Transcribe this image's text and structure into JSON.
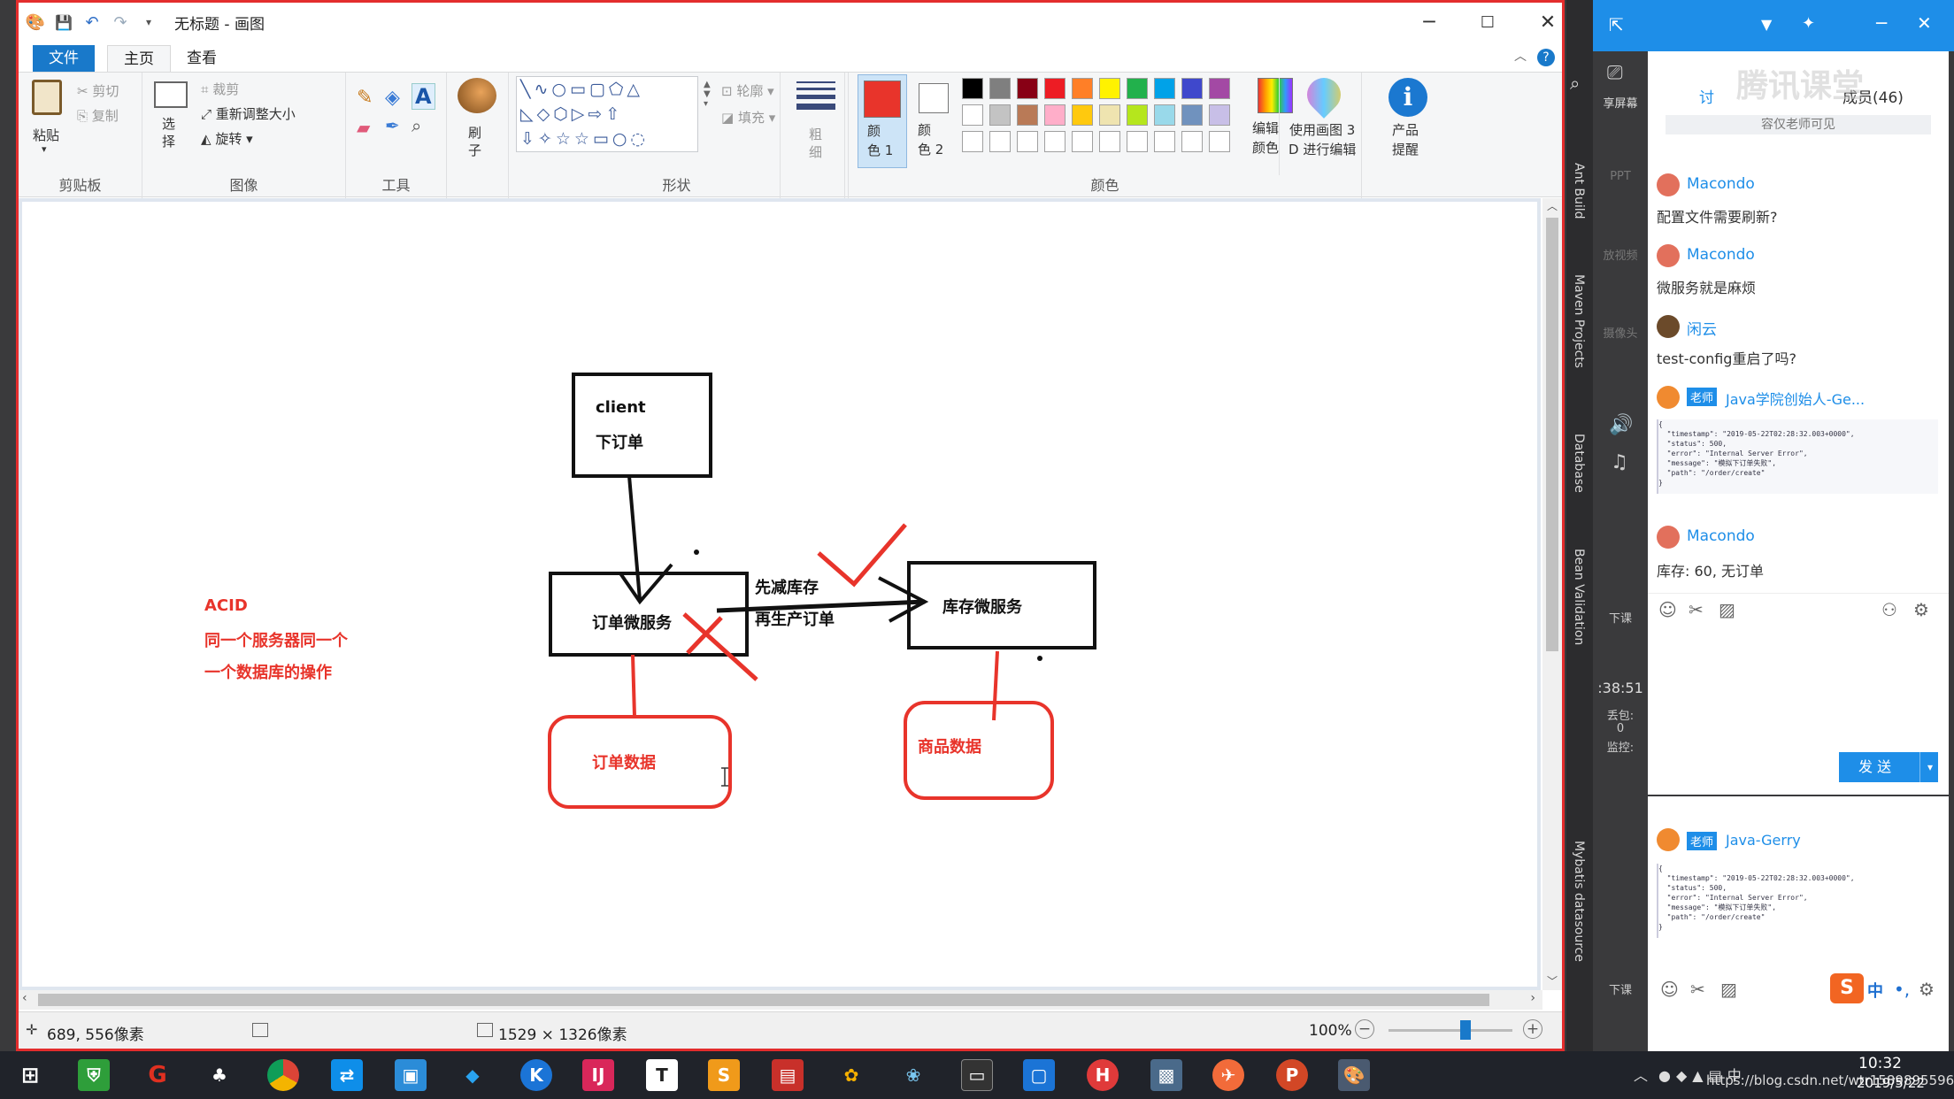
{
  "window": {
    "title": "无标题 - 画图",
    "quick_access": [
      "save",
      "undo",
      "redo"
    ]
  },
  "tabs": {
    "file": "文件",
    "home": "主页",
    "view": "查看"
  },
  "ribbon": {
    "clipboard": {
      "paste": "粘贴",
      "cut": "剪切",
      "copy": "复制",
      "label": "剪贴板"
    },
    "image": {
      "select": "选\n择",
      "crop": "裁剪",
      "resize": "重新调整大小",
      "rotate": "旋转",
      "label": "图像"
    },
    "tools": {
      "label": "工具"
    },
    "brush": {
      "label": "刷\n子"
    },
    "shapes": {
      "outline": "轮廓",
      "fill": "填充",
      "label": "形状"
    },
    "size": {
      "label": "粗\n细"
    },
    "color1": {
      "label": "颜\n色 1",
      "value": "#e8342b"
    },
    "color2": {
      "label": "颜\n色 2",
      "value": "#ffffff"
    },
    "colors": {
      "label": "颜色",
      "row1": [
        "#000000",
        "#7f7f7f",
        "#880015",
        "#ed1c24",
        "#ff7f27",
        "#fff200",
        "#22b14c",
        "#00a2e8",
        "#3f48cc",
        "#a349a4"
      ],
      "row2": [
        "#ffffff",
        "#c3c3c3",
        "#b97a57",
        "#ffaec9",
        "#ffc90e",
        "#efe4b0",
        "#b5e61d",
        "#99d9ea",
        "#7092be",
        "#c8bfe7"
      ]
    },
    "edit_colors": "编辑\n颜色",
    "paint3d": "使用画图 3\nD 进行编辑",
    "product_alert": "产品\n提醒"
  },
  "diagram": {
    "client_line1": "client",
    "client_line2": "下订单",
    "order_service": "订单微服务",
    "stock_service": "库存微服务",
    "arrow_text1": "先减库存",
    "arrow_text2": "再生产订单",
    "order_data": "订单数据",
    "goods_data": "商品数据",
    "acid_title": "ACID",
    "acid_line1": "同一个服务器同一个",
    "acid_line2": "一个数据库的操作"
  },
  "status": {
    "cursor": "689, 556像素",
    "canvas_size": "1529 × 1326像素",
    "zoom": "100%",
    "zoom_fraction": 0.62
  },
  "ide_tabs": [
    "Ant Build",
    "Maven Projects",
    "Database",
    "Bean Validation",
    "Mybatis datasource"
  ],
  "chat": {
    "tab_discussion": "讨",
    "members_label": "成员(46)",
    "watermark": "腾讯课堂",
    "notice": "容仅老师可见",
    "messages": [
      {
        "name": "Macondo",
        "text": "配置文件需要刷新?"
      },
      {
        "name": "Macondo",
        "text": "微服务就是麻烦"
      },
      {
        "name": "闲云",
        "text": "test-config重启了吗?"
      },
      {
        "name": "Java学院创始人-Ge...",
        "badge": "老师",
        "json": "{\n  \"timestamp\": \"2019-05-22T02:28:32.003+0000\",\n  \"status\": 500,\n  \"error\": \"Internal Server Error\",\n  \"message\": \"模拟下订单失败\",\n  \"path\": \"/order/create\"\n}"
      },
      {
        "name": "Macondo",
        "text": "库存: 60, 无订单"
      }
    ],
    "send": "发 送",
    "lower_name": "Java-Gerry",
    "lower_badge": "老师",
    "lower_json": "{\n  \"timestamp\": \"2019-05-22T02:28:32.003+0000\",\n  \"status\": 500,\n  \"error\": \"Internal Server Error\",\n  \"message\": \"模拟下订单失败\",\n  \"path\": \"/order/create\"\n}",
    "side_texts": [
      "享屏幕",
      "PPT",
      "放视频",
      "摄像头",
      "下课",
      ":38:51",
      "丢包:",
      "0",
      "监控:",
      "下课"
    ]
  },
  "taskbar": {
    "time": "10:32",
    "date": "2019/5/22",
    "url_overlay": "https://blog.csdn.net/wtr15898955965",
    "ime": "中"
  }
}
